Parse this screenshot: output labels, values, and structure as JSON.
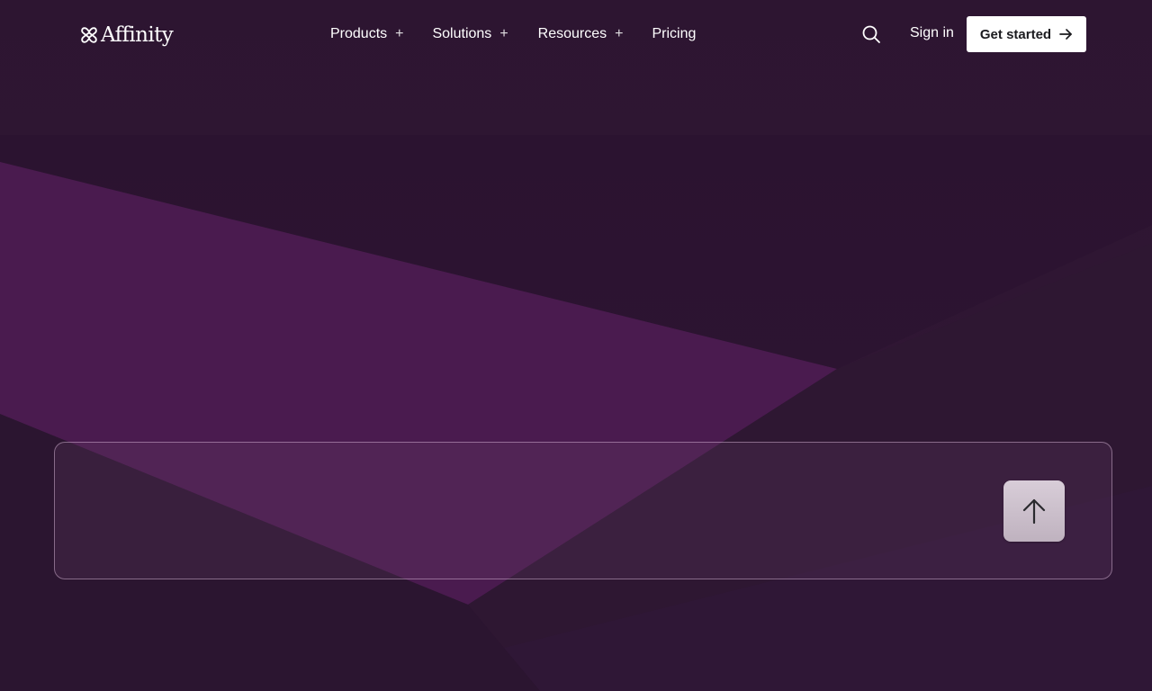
{
  "brand": {
    "name": "Affinity"
  },
  "nav": {
    "items": [
      {
        "label": "Products",
        "expand_icon": "plus-icon"
      },
      {
        "label": "Solutions",
        "expand_icon": "plus-icon"
      },
      {
        "label": "Resources",
        "expand_icon": "plus-icon"
      },
      {
        "label": "Pricing"
      }
    ],
    "search_icon": "search-icon",
    "sign_in_label": "Sign in",
    "cta_label": "Get started",
    "cta_icon": "arrow-right-icon"
  },
  "prompt": {
    "value": "",
    "placeholder": "",
    "send_icon": "arrow-up-icon"
  },
  "colors": {
    "background": "#341a37",
    "accent_purple": "#4e1b52",
    "cta_background": "#ffffff",
    "cta_text": "#1b1b1f",
    "send_button": "#cfc4cf"
  }
}
